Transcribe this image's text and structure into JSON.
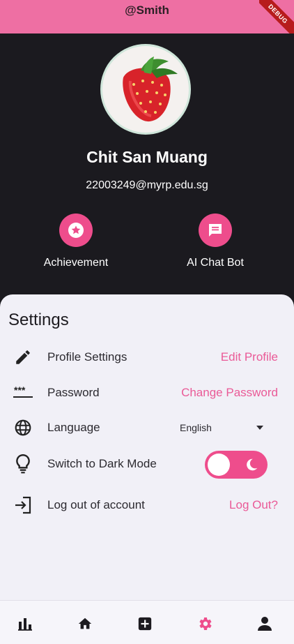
{
  "appbar": {
    "title": "@Smith",
    "debug_label": "DEBUG"
  },
  "profile": {
    "name": "Chit San Muang",
    "email": "22003249@myrp.edu.sg",
    "actions": [
      {
        "label": "Achievement",
        "icon": "star-badge-icon"
      },
      {
        "label": "AI Chat Bot",
        "icon": "chat-icon"
      }
    ]
  },
  "settings": {
    "title": "Settings",
    "rows": [
      {
        "label": "Profile Settings",
        "icon": "pencil-icon",
        "action": "Edit Profile"
      },
      {
        "label": "Password",
        "icon": "password-icon",
        "action": "Change Password"
      },
      {
        "label": "Language",
        "icon": "globe-icon",
        "select_value": "English"
      },
      {
        "label": "Switch to Dark Mode",
        "icon": "lightbulb-icon",
        "toggle_on": true
      },
      {
        "label": "Log out of account",
        "icon": "logout-icon",
        "action": "Log Out?"
      }
    ]
  },
  "nav": {
    "items": [
      {
        "icon": "bar-chart-icon",
        "active": false
      },
      {
        "icon": "home-icon",
        "active": false
      },
      {
        "icon": "add-box-icon",
        "active": false
      },
      {
        "icon": "gear-icon",
        "active": true
      },
      {
        "icon": "person-icon",
        "active": false
      }
    ]
  },
  "colors": {
    "accent": "#ee4d8c",
    "appbar": "#ee6fa3",
    "link": "#ea5a97",
    "dark_bg": "#1b1a1f",
    "panel_bg": "#f1f0f7"
  }
}
